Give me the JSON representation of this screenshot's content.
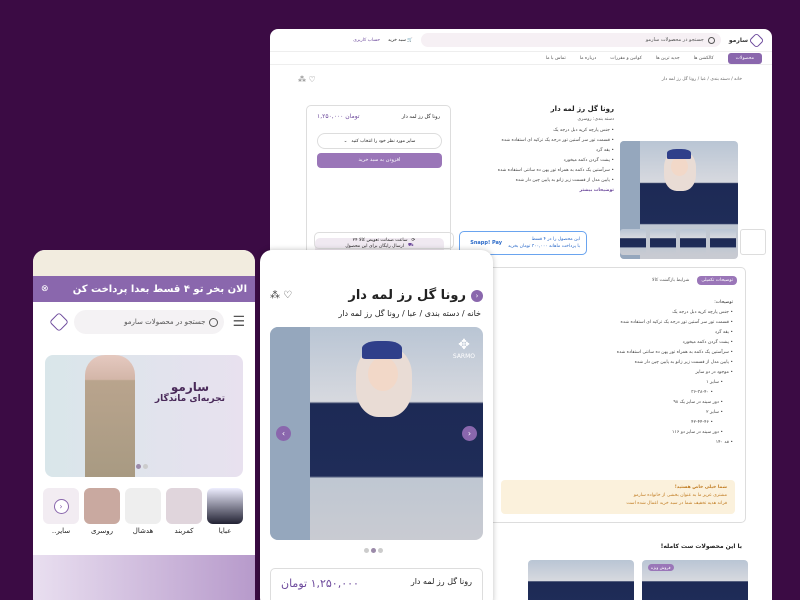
{
  "desktop": {
    "logo": "سارمو",
    "search_placeholder": "جستجو در محصولات سارمو",
    "cart": "سبد خرید",
    "account": "حساب کاربری",
    "nav": [
      "محصولات",
      "کالکشن ها",
      "جدید ترین ها",
      "کوانین و مقررات",
      "درباره ما",
      "تماس با ما"
    ],
    "breadcrumb": "خانه / دسته بندی / عبا / رونا گل رز لمه دار",
    "product_title": "رونا گل رز لمه دار",
    "category": "دسته بندی: روسری",
    "features": [
      "جنس پارچه کرپه دبل درجه یک",
      "قسمت تور سر آستین تور درجه یک ترکیه ای استفاده شده",
      "یقه گرد",
      "پشت گردن دکمه میخورد",
      "سرآستین یک دکمه به همراه تور پهن ده سانتی استفاده شده",
      "پایین مدل از قسمت زیر زانو به پایین چین دار شده"
    ],
    "more": "توضیحات بیشتر",
    "price": "۱,۲۵۰,۰۰۰ تومان",
    "buy_name": "رونا گل رز لمه دار",
    "size_select": "سایز مورد نظر خود را انتخاب کنید",
    "add_cart": "افزودن به سبد خرید",
    "free_ship": "ارسال رایگان برای این محصول",
    "warranty": "۲۴ ساعت ضمانت تعویض کالا",
    "snapp_line1": "این محصول را در ۴ قسط",
    "snapp_line2": "با پرداخت ماهانه ۳۰۰,۰۰۰ تومان بخرید",
    "snapp_logo": "Snapp! Pay",
    "tabs": [
      "توضیحات تکمیلی",
      "شرایط بازگشت کالا"
    ],
    "desc_title": "توضیحات:",
    "desc_items": [
      "جنس پارچه کرپه دبل درجه یک",
      "قسمت تور سر آستین تور درجه یک ترکیه ای استفاده شده",
      "یقه گرد",
      "پشت گردن دکمه میخورد",
      "سرآستین یک دکمه به همراه تور پهن ده سانتی استفاده شده",
      "پایین مدل از قسمت زیر زانو به پایین چین دار شده",
      "موجود در دو سایز",
      "سایز ۱",
      "۳۶-۳۸-۴۰",
      "دور سینه در سایز یک ۹۸",
      "سایز ۲",
      "۴۲-۴۴-۴۶",
      "دور سینه در سایز دو ۱۱۶",
      "قد ۱۴۰"
    ],
    "notice_title": "شما خیلی خاص هستید!",
    "notice_line1": "مشتری عزیز ما به عنوان بخشی از خانواده سارمو",
    "notice_line2": "فراند هدیه تخفیف شما در سبد خرید اعمال شده است",
    "related": "با این محصولات ست کامله!",
    "badge": "فروش ویژه"
  },
  "phone1": {
    "banner": "الان بخر تو ۴ قسط بعدا پرداخت کن",
    "search_placeholder": "جستجو در محصولات سارمو",
    "hero_title": "سارمو",
    "hero_sub": "تجربه‌ای ماندگار",
    "cats": [
      "عبایا",
      "کمربند",
      "هدشال",
      "روسری",
      "سایر.."
    ]
  },
  "phone2": {
    "title": "رونا گل رز لمه دار",
    "breadcrumb": "خانه / دسته بندی / عبا / رونا گل رز لمه دار",
    "brand": "SARMO",
    "name": "رونا گل رز لمه دار",
    "price": "۱,۲۵۰,۰۰۰ تومان"
  },
  "colors": {
    "accent": "#8a67ad",
    "bg": "#3b0b44"
  }
}
